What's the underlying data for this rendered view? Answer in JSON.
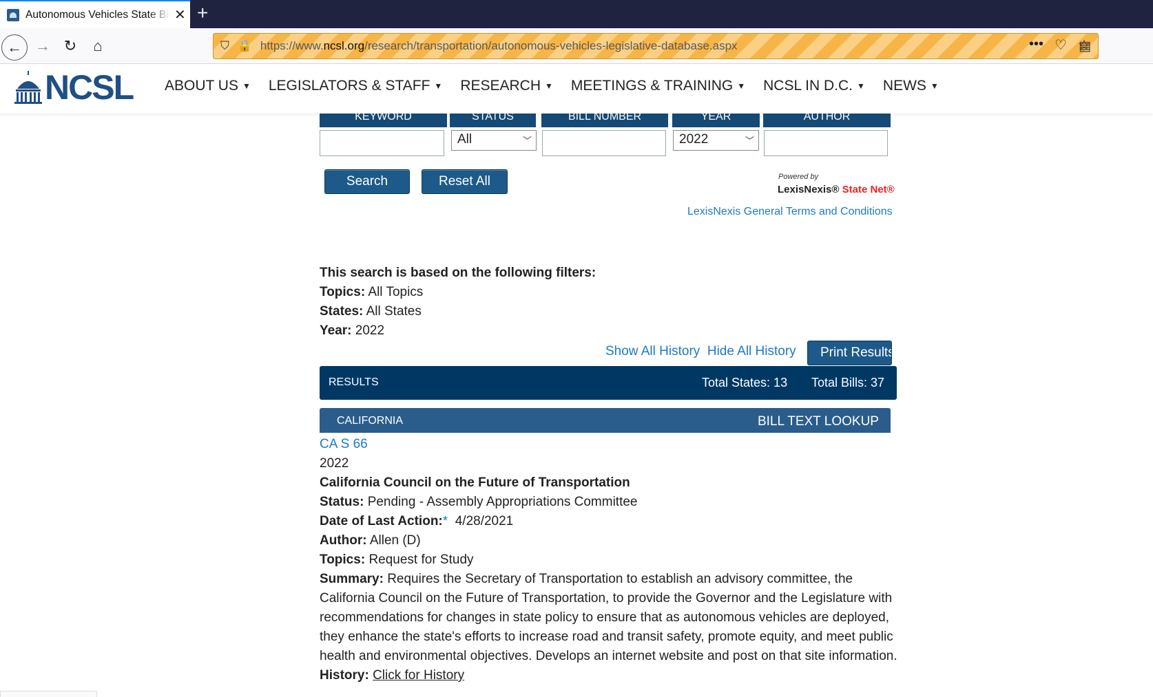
{
  "browser": {
    "tab_title": "Autonomous Vehicles State Bill",
    "url_prefix": "https://www.",
    "url_domain": "ncsl.org",
    "url_path": "/research/transportation/autonomous-vehicles-legislative-database.aspx"
  },
  "site": {
    "logo_text": "NCSL",
    "menu": [
      "ABOUT US",
      "LEGISLATORS & STAFF",
      "RESEARCH",
      "MEETINGS & TRAINING",
      "NCSL IN D.C.",
      "NEWS"
    ]
  },
  "form": {
    "keyword_label": "KEYWORD",
    "status_label": "STATUS",
    "bill_number_label": "BILL NUMBER",
    "year_label": "YEAR",
    "author_label": "AUTHOR",
    "status_value": "All",
    "year_value": "2022",
    "search_label": "Search",
    "reset_label": "Reset All",
    "powered_by": "Powered by",
    "lexis_name": "LexisNexis®",
    "statenet_name": "State Net®",
    "terms_link": "LexisNexis General Terms and Conditions"
  },
  "filters": {
    "heading": "This search is based on the following filters:",
    "topics_label": "Topics:",
    "topics_value": "All Topics",
    "states_label": "States:",
    "states_value": "All States",
    "year_label": "Year:",
    "year_value": "2022"
  },
  "history": {
    "show_all": "Show All History",
    "hide_all": "Hide All History",
    "print": "Print Results"
  },
  "results": {
    "label": "RESULTS",
    "total_states": "Total States: 13",
    "total_bills": "Total Bills: 37"
  },
  "state": {
    "name": "CALIFORNIA",
    "lookup": "BILL TEXT LOOKUP"
  },
  "bill": {
    "id": "CA S 66",
    "year": "2022",
    "title": "California Council on the Future of Transportation",
    "status_label": "Status:",
    "status_value": "Pending - Assembly Appropriations Committee",
    "date_label": "Date of Last Action:",
    "date_asterisk": "*",
    "date_value": "4/28/2021",
    "author_label": "Author:",
    "author_value": "Allen (D)",
    "topics_label": "Topics:",
    "topics_value": "Request for Study",
    "summary_label": "Summary:",
    "summary_value": "Requires the Secretary of Transportation to establish an advisory committee, the California Council on the Future of Transportation, to provide the Governor and the Legislature with recommendations for changes in state policy to ensure that as autonomous vehicles are deployed, they enhance the state's efforts to increase road and transit safety, promote equity, and meet public health and environmental objectives. Develops an internet website and post on that site information.",
    "history_label": "History:",
    "history_link": "Click for History"
  }
}
